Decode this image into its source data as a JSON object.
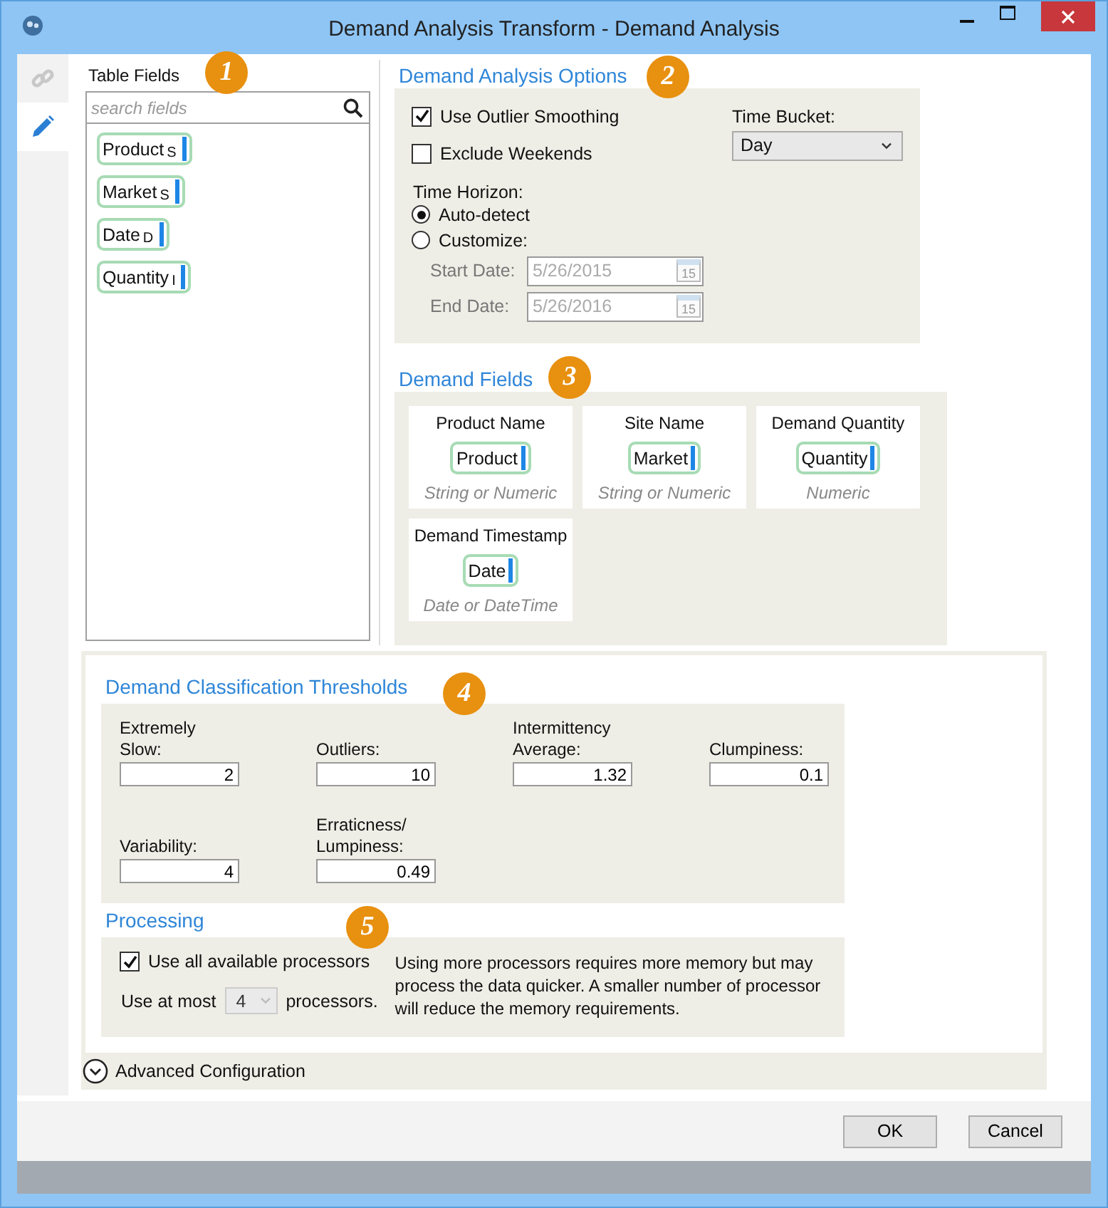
{
  "window": {
    "title": "Demand Analysis Transform - Demand Analysis"
  },
  "side_tabs": [
    {
      "kind": "link",
      "selected": false
    },
    {
      "kind": "edit",
      "selected": true
    }
  ],
  "table_fields": {
    "title": "Table Fields",
    "badge": "1",
    "search": {
      "placeholder": "search fields"
    },
    "fields": [
      {
        "name": "Product",
        "type_code": "S"
      },
      {
        "name": "Market",
        "type_code": "S"
      },
      {
        "name": "Date",
        "type_code": "D"
      },
      {
        "name": "Quantity",
        "type_code": "I"
      }
    ]
  },
  "options": {
    "title": "Demand Analysis Options",
    "badge": "2",
    "checkboxes": [
      {
        "label": "Use Outlier Smoothing",
        "checked": true
      },
      {
        "label": "Exclude Weekends",
        "checked": false
      }
    ],
    "time_bucket": {
      "label": "Time Bucket:",
      "value": "Day"
    },
    "time_horizon": {
      "label": "Time Horizon:",
      "options": [
        {
          "label": "Auto-detect",
          "selected": true
        },
        {
          "label": "Customize:",
          "selected": false
        }
      ],
      "dates": [
        {
          "label": "Start Date:",
          "value": "5/26/2015",
          "calendar_day": "15",
          "disabled": true
        },
        {
          "label": "End Date:",
          "value": "5/26/2016",
          "calendar_day": "15",
          "disabled": true
        }
      ]
    }
  },
  "demand_fields": {
    "title": "Demand Fields",
    "badge": "3",
    "slots": [
      {
        "label": "Product Name",
        "value": "Product",
        "hint": "String or Numeric"
      },
      {
        "label": "Site Name",
        "value": "Market",
        "hint": "String or Numeric"
      },
      {
        "label": "Demand Quantity",
        "value": "Quantity",
        "hint": "Numeric"
      },
      {
        "label": "Demand Timestamp",
        "value": "Date",
        "hint": "Date or DateTime"
      }
    ]
  },
  "thresholds": {
    "title": "Demand Classification Thresholds",
    "badge": "4",
    "fields": [
      {
        "label": "Extremely\nSlow:",
        "value": "2"
      },
      {
        "label": "Outliers:",
        "value": "10"
      },
      {
        "label": "Intermittency\nAverage:",
        "value": "1.32"
      },
      {
        "label": "Clumpiness:",
        "value": "0.1"
      },
      {
        "label": "Variability:",
        "value": "4"
      },
      {
        "label": "Erraticness/\nLumpiness:",
        "value": "0.49"
      }
    ]
  },
  "processing": {
    "title": "Processing",
    "badge": "5",
    "use_all": {
      "label": "Use all available processors",
      "checked": true
    },
    "use_at_most": {
      "prefix": "Use at most",
      "value": "4",
      "suffix": "processors.",
      "disabled": true
    },
    "note": "Using more processors requires more memory but may process the data quicker. A smaller number of processor will reduce the memory requirements."
  },
  "advanced": {
    "label": "Advanced Configuration",
    "expanded": false
  },
  "buttons": [
    {
      "label": "OK"
    },
    {
      "label": "Cancel"
    }
  ]
}
